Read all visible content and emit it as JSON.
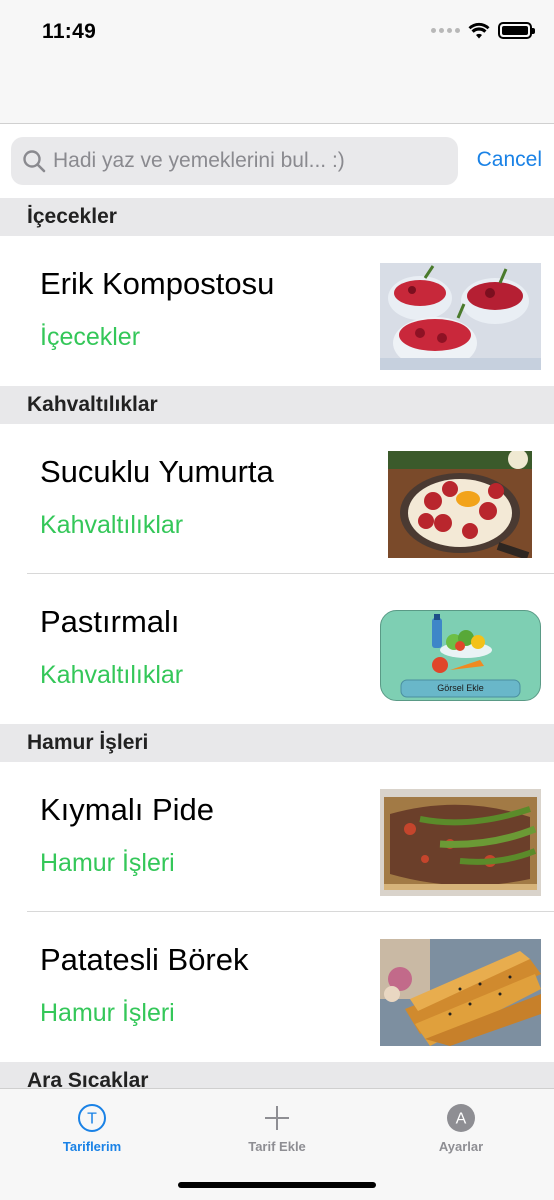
{
  "status_bar": {
    "time": "11:49"
  },
  "search": {
    "placeholder": "Hadi yaz ve yemeklerini bul... :)",
    "cancel_label": "Cancel"
  },
  "sections": [
    {
      "title": "İçecekler",
      "items": [
        {
          "title": "Erik Kompostosu",
          "category": "İçecekler",
          "image": "plum-compote-image"
        }
      ]
    },
    {
      "title": "Kahvaltılıklar",
      "items": [
        {
          "title": "Sucuklu Yumurta",
          "category": "Kahvaltılıklar",
          "image": "sausage-egg-image"
        },
        {
          "title": "Pastırmalı",
          "category": "Kahvaltılıklar",
          "image": "add-image-placeholder",
          "placeholder_label": "Görsel Ekle"
        }
      ]
    },
    {
      "title": "Hamur İşleri",
      "items": [
        {
          "title": "Kıymalı Pide",
          "category": "Hamur İşleri",
          "image": "pide-image"
        },
        {
          "title": "Patatesli Börek",
          "category": "Hamur İşleri",
          "image": "borek-image"
        }
      ]
    },
    {
      "title": "Ara Sıcaklar",
      "items": []
    }
  ],
  "tab_bar": {
    "tabs": [
      {
        "label": "Tariflerim",
        "icon": "letter-t-circle-icon",
        "icon_letter": "T",
        "active": true
      },
      {
        "label": "Tarif Ekle",
        "icon": "plus-icon",
        "active": false
      },
      {
        "label": "Ayarlar",
        "icon": "letter-a-circle-icon",
        "icon_letter": "A",
        "active": false
      }
    ]
  },
  "colors": {
    "accent": "#1a82e6",
    "category_text": "#34c759",
    "section_header_bg": "#e8e8ea"
  }
}
